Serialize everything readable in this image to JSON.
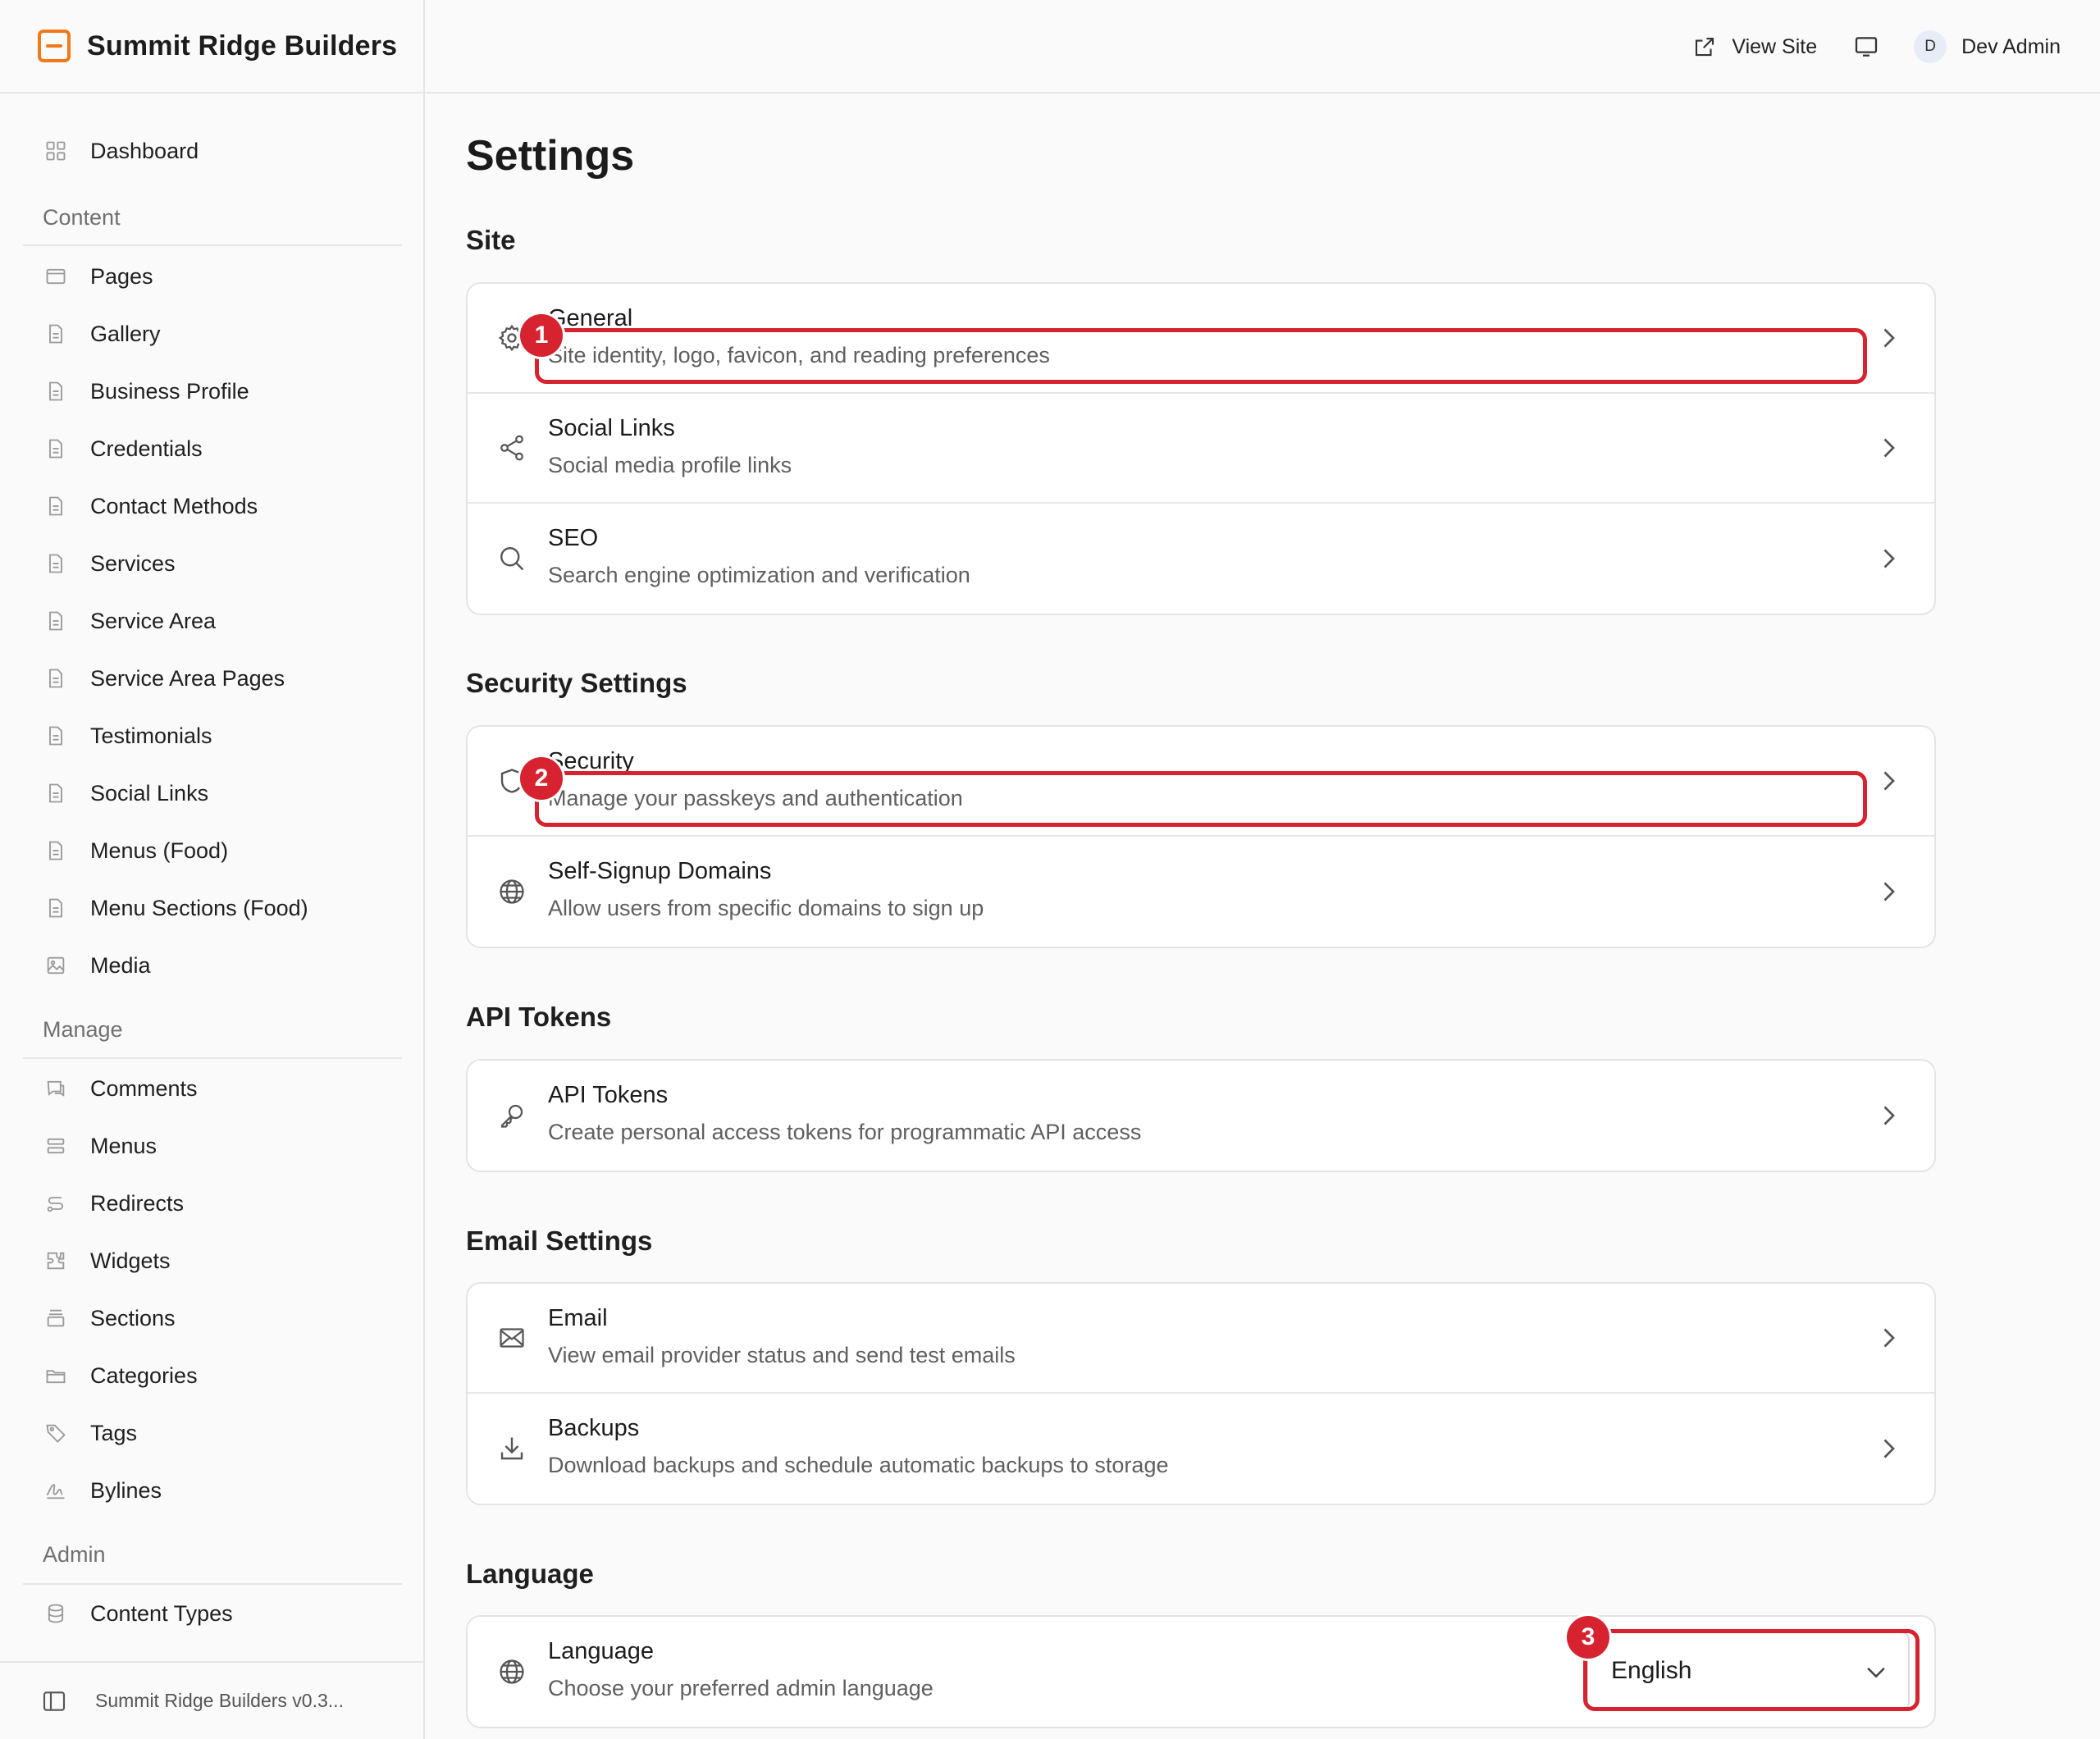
{
  "brand": {
    "name": "Summit Ridge Builders"
  },
  "topbar": {
    "view_site": "View Site",
    "avatar_initial": "D",
    "user_name": "Dev Admin"
  },
  "sidebar": {
    "dashboard": "Dashboard",
    "groups": {
      "content": "Content",
      "manage": "Manage",
      "admin": "Admin"
    },
    "content_items": [
      "Pages",
      "Gallery",
      "Business Profile",
      "Credentials",
      "Contact Methods",
      "Services",
      "Service Area",
      "Service Area Pages",
      "Testimonials",
      "Social Links",
      "Menus (Food)",
      "Menu Sections (Food)",
      "Media"
    ],
    "manage_items": [
      "Comments",
      "Menus",
      "Redirects",
      "Widgets",
      "Sections",
      "Categories",
      "Tags",
      "Bylines"
    ],
    "admin_items": [
      "Content Types"
    ],
    "footer": "Summit Ridge Builders v0.3..."
  },
  "page": {
    "title": "Settings"
  },
  "sections": {
    "site": {
      "title": "Site",
      "rows": [
        {
          "title": "General",
          "desc": "Site identity, logo, favicon, and reading preferences",
          "icon": "gear-icon"
        },
        {
          "title": "Social Links",
          "desc": "Social media profile links",
          "icon": "share-icon"
        },
        {
          "title": "SEO",
          "desc": "Search engine optimization and verification",
          "icon": "search-icon"
        }
      ]
    },
    "security": {
      "title": "Security Settings",
      "rows": [
        {
          "title": "Security",
          "desc": "Manage your passkeys and authentication",
          "icon": "shield-icon"
        },
        {
          "title": "Self-Signup Domains",
          "desc": "Allow users from specific domains to sign up",
          "icon": "globe-icon"
        }
      ]
    },
    "api": {
      "title": "API Tokens",
      "rows": [
        {
          "title": "API Tokens",
          "desc": "Create personal access tokens for programmatic API access",
          "icon": "key-icon"
        }
      ]
    },
    "email": {
      "title": "Email Settings",
      "rows": [
        {
          "title": "Email",
          "desc": "View email provider status and send test emails",
          "icon": "mail-icon"
        },
        {
          "title": "Backups",
          "desc": "Download backups and schedule automatic backups to storage",
          "icon": "download-icon"
        }
      ]
    },
    "language": {
      "title": "Language",
      "row": {
        "title": "Language",
        "desc": "Choose your preferred admin language",
        "icon": "globe-icon"
      },
      "selected": "English"
    }
  },
  "annotations": [
    "1",
    "2",
    "3"
  ],
  "colors": {
    "accent": "#f07a1a",
    "annotation": "#d6232f"
  }
}
